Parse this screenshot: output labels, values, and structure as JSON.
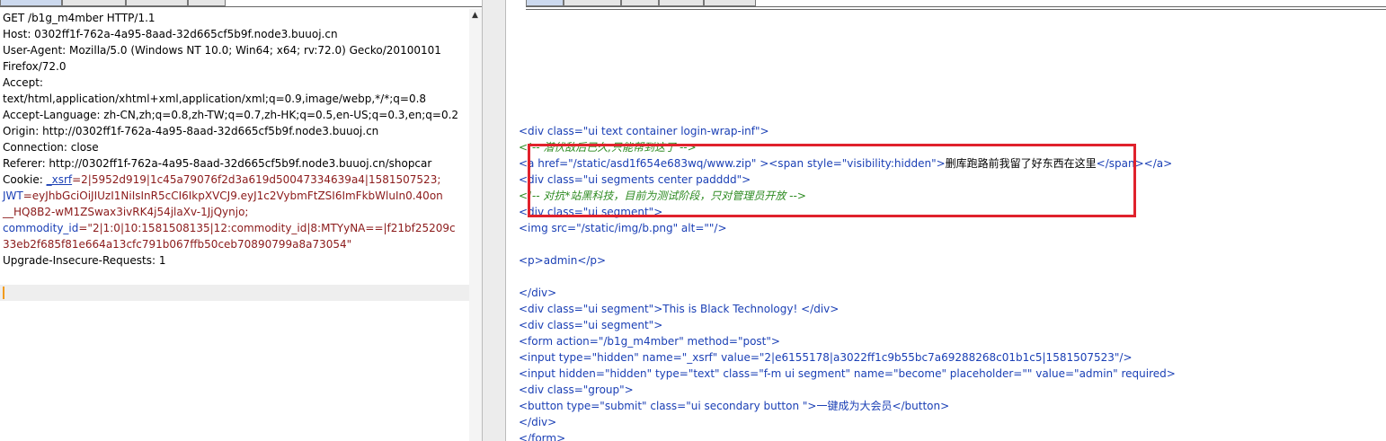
{
  "request": {
    "lines": [
      "GET /b1g_m4mber HTTP/1.1",
      "Host: 0302ff1f-762a-4a95-8aad-32d665cf5b9f.node3.buuoj.cn",
      "User-Agent: Mozilla/5.0 (Windows NT 10.0; Win64; x64; rv:72.0) Gecko/20100101",
      "Firefox/72.0",
      "Accept:",
      "text/html,application/xhtml+xml,application/xml;q=0.9,image/webp,*/*;q=0.8",
      "Accept-Language: zh-CN,zh;q=0.8,zh-TW;q=0.7,zh-HK;q=0.5,en-US;q=0.3,en;q=0.2",
      "Origin: http://0302ff1f-762a-4a95-8aad-32d665cf5b9f.node3.buuoj.cn",
      "Connection: close",
      "Referer: http://0302ff1f-762a-4a95-8aad-32d665cf5b9f.node3.buuoj.cn/shopcar"
    ],
    "cookie_label": "Cookie: ",
    "xsrf_key": "_xsrf",
    "xsrf_val": "=2|5952d919|1c45a79076f2d3a619d50047334639a4|1581507523;",
    "jwt_key": "JWT",
    "jwt_val1": "=eyJhbGciOiJIUzI1NiIsInR5cCI6IkpXVCJ9.eyJ1c2VybmFtZSI6ImFkbWluIn0.40on",
    "jwt_val2": "__HQ8B2-wM1ZSwax3ivRK4j54jlaXv-1JjQynjo;",
    "commodity_key": "commodity_id",
    "commodity_val1": "=\"2|1:0|10:1581508135|12:commodity_id|8:MTYyNA==|f21bf25209c",
    "commodity_val2": "33eb2f685f81e664a13cfc791b067ffb50ceb70890799a8a73054\"",
    "upgrade": "Upgrade-Insecure-Requests: 1"
  },
  "response": {
    "l1": "<div class=\"ui text container login-wrap-inf\">",
    "l2": "<!-- 潜伏敌后已久,只能帮到这了 -->",
    "l3a": "<a href=\"/static/asd1f654e683wq/www.zip\" ><span style=\"visibility:hidden\">",
    "l3b": "删库跑路前我留了好东西在这里",
    "l3c": "</span></a>",
    "l4": "<div class=\"ui segments center padddd\">",
    "l5": "<!-- 对抗*站黑科技，目前为测试阶段，只对管理员开放 -->",
    "l6": "<div class=\"ui segment\">",
    "l7": "<img src=\"/static/img/b.png\" alt=\"\"/>",
    "l8": "",
    "l9": "<p>admin</p>",
    "l10": "",
    "l11": "</div>",
    "l12": "<div class=\"ui segment\">This is Black Technology! </div>",
    "l13": "<div class=\"ui segment\">",
    "l14": "<form action=\"/b1g_m4mber\" method=\"post\">",
    "l15": "<input type=\"hidden\" name=\"_xsrf\" value=\"2|e6155178|a3022ff1c9b55bc7a69288268c01b1c5|1581507523\"/>",
    "l16": "<input hidden=\"hidden\" type=\"text\" class=\"f-m ui segment\" name=\"become\" placeholder=\"\" value=\"admin\" required>",
    "l17": "<div class=\"group\">",
    "l18": "<button type=\"submit\" class=\"ui secondary button \">一键成为大会员</button>",
    "l19": "</div>",
    "l20": "</form>"
  },
  "colors": {
    "highlight_box": "#e0222c",
    "caret": "#f29b1d"
  }
}
